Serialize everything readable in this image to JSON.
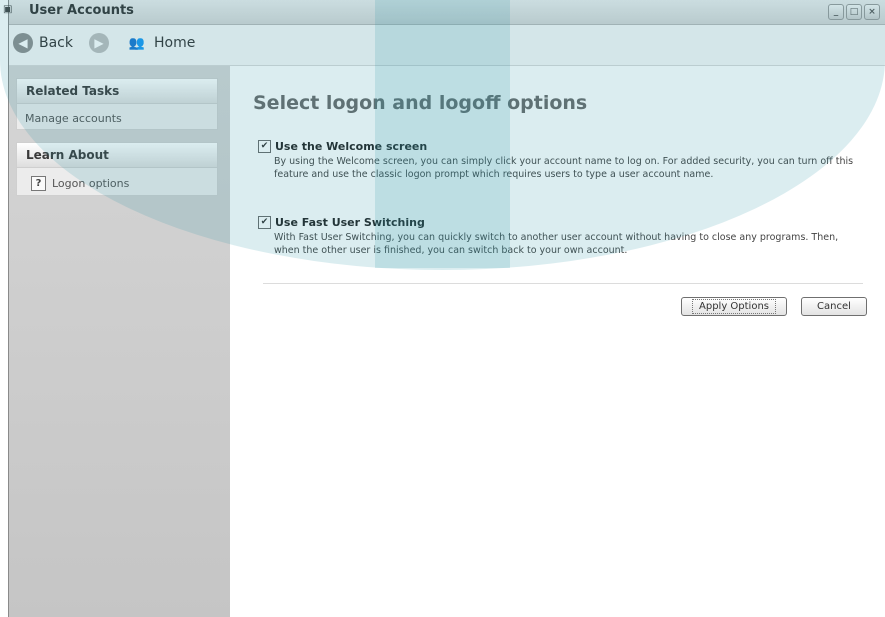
{
  "window": {
    "title": "User Accounts"
  },
  "nav": {
    "back_label": "Back",
    "home_label": "Home"
  },
  "sidebar": {
    "related_tasks": {
      "title": "Related Tasks",
      "items": [
        {
          "label": "Manage accounts"
        }
      ]
    },
    "learn_about": {
      "title": "Learn About",
      "items": [
        {
          "label": "Logon options",
          "icon": "help-icon"
        }
      ]
    }
  },
  "main": {
    "heading": "Select logon and logoff options",
    "options": [
      {
        "label": "Use the Welcome screen",
        "checked": true,
        "description": "By using the Welcome screen, you can simply click your account name to log on. For added security, you can turn off this feature and use the classic logon prompt which requires users to type a user account name."
      },
      {
        "label": "Use Fast User Switching",
        "checked": true,
        "description": "With Fast User Switching, you can quickly switch to another user account without having to close any programs. Then, when the other user is finished, you can switch back to your own account."
      }
    ],
    "apply_label": "Apply Options",
    "cancel_label": "Cancel"
  }
}
